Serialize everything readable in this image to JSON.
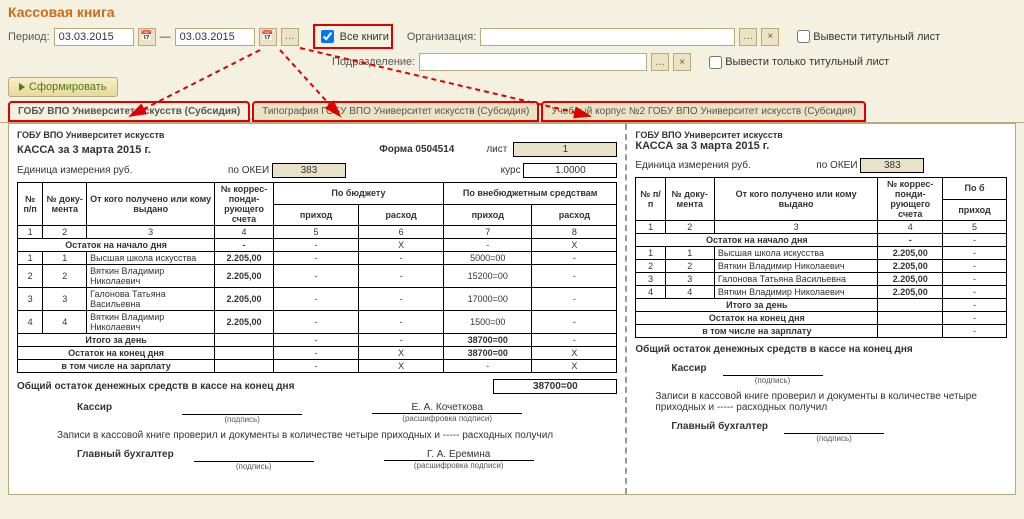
{
  "title": "Кассовая книга",
  "period_label": "Период:",
  "date_from": "03.03.2015",
  "date_to": "03.03.2015",
  "all_books_label": "Все книги",
  "org_label": "Организация:",
  "subdiv_label": "Подразделение:",
  "chk_title_label": "Вывести титульный лист",
  "chk_only_title_label": "Вывести только титульный лист",
  "form_button": "Сформировать",
  "tabs": [
    "ГОБУ ВПО Университет искусств (Субсидия)",
    "Типография ГОБУ ВПО Университет искусств (Субсидия)",
    "Учебный корпус №2 ГОБУ ВПО Университет искусств (Субсидия)"
  ],
  "sheet": {
    "org": "ГОБУ ВПО Университет искусств",
    "cash_date": "КАССА за 3 марта 2015 г.",
    "form_label": "Форма 0504514",
    "list_label": "лист",
    "list_value": "1",
    "unit_label": "Единица измерения  руб.",
    "okei_label": "по ОКЕИ",
    "okei_value": "383",
    "kurs_label": "курс",
    "kurs_value": "1.0000",
    "col_np": "№ п/п",
    "col_doc": "№ доку- мента",
    "col_who": "От кого получено или кому выдано",
    "col_acc": "№ коррес- понди- рующего счета",
    "col_budget": "По бюджету",
    "col_offbudget": "По внебюджетным средствам",
    "col_in": "приход",
    "col_out": "расход",
    "nums": [
      "1",
      "2",
      "3",
      "4",
      "5",
      "6",
      "7",
      "8"
    ],
    "open_label": "Остаток на начало дня",
    "rows": [
      {
        "n": "1",
        "d": "1",
        "who": "Высшая школа искусства",
        "acc": "2.205,00",
        "in": "-",
        "out": "-",
        "oi": "5000=00",
        "oo": "-"
      },
      {
        "n": "2",
        "d": "2",
        "who": "Вяткин Владимир Николаевич",
        "acc": "2.205,00",
        "in": "-",
        "out": "-",
        "oi": "15200=00",
        "oo": "-"
      },
      {
        "n": "3",
        "d": "3",
        "who": "Галонова Татьяна  Васильевна",
        "acc": "2.205,00",
        "in": "-",
        "out": "-",
        "oi": "17000=00",
        "oo": "-"
      },
      {
        "n": "4",
        "d": "4",
        "who": "Вяткин Владимир Николаевич",
        "acc": "2.205,00",
        "in": "-",
        "out": "-",
        "oi": "1500=00",
        "oo": "-"
      }
    ],
    "total_day_label": "Итого за день",
    "total_day_value": "38700=00",
    "close_label": "Остаток на конец  дня",
    "close_value": "38700=00",
    "salary_label": "в том числе на зарплату",
    "grand_label": "Общий остаток денежных средств в кассе на конец дня",
    "grand_value": "38700=00",
    "cashier_label": "Кассир",
    "cashier_name": "Е. А. Кочеткова",
    "sig_hint1": "(подпись)",
    "sig_hint2": "(расшифровка подписи)",
    "check_text": "Записи в кассовой книге проверил и документы в количестве четыре приходных и ----- расходных получил",
    "acc_label": "Главный бухгалтер",
    "acc_name": "Г. А. Еремина",
    "col_po_b": "По б"
  },
  "sheet2": {
    "rows_acc": [
      "2.205,00",
      "2.205,00",
      "2.205,00",
      "2.205,00"
    ]
  }
}
